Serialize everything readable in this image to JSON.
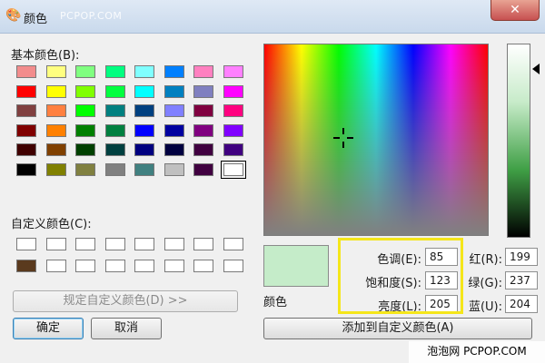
{
  "window": {
    "title": "颜色",
    "watermark_top": "PCPOP.COM",
    "close_glyph": "✕",
    "title_icon": "palette-icon"
  },
  "basic_colors": {
    "label": "基本颜色(B):",
    "rows": [
      [
        "#f28c8c",
        "#ffff80",
        "#80ff80",
        "#00ff80",
        "#80ffff",
        "#0080ff",
        "#ff80c0",
        "#ff80ff"
      ],
      [
        "#ff0000",
        "#ffff00",
        "#80ff00",
        "#00ff40",
        "#00ffff",
        "#0080c0",
        "#8080c0",
        "#ff00ff"
      ],
      [
        "#804040",
        "#ff8040",
        "#00ff00",
        "#008080",
        "#004080",
        "#8080ff",
        "#800040",
        "#ff0080"
      ],
      [
        "#800000",
        "#ff8000",
        "#008000",
        "#008040",
        "#0000ff",
        "#0000a0",
        "#800080",
        "#8000ff"
      ],
      [
        "#400000",
        "#804000",
        "#004000",
        "#004040",
        "#000080",
        "#000040",
        "#400040",
        "#400080"
      ],
      [
        "#000000",
        "#808000",
        "#808040",
        "#808080",
        "#408080",
        "#c0c0c0",
        "#400040",
        "#ffffff"
      ]
    ]
  },
  "custom_colors": {
    "label": "自定义颜色(C):",
    "rows": [
      [
        "#ffffff",
        "#ffffff",
        "#ffffff",
        "#ffffff",
        "#ffffff",
        "#ffffff",
        "#ffffff",
        "#ffffff"
      ],
      [
        "#5a3a1e",
        "#ffffff",
        "#ffffff",
        "#ffffff",
        "#ffffff",
        "#ffffff",
        "#ffffff",
        "#ffffff"
      ]
    ]
  },
  "buttons": {
    "define_custom": "规定自定义颜色(D) >>",
    "ok": "确定",
    "cancel": "取消",
    "add_custom": "添加到自定义颜色(A)"
  },
  "preview": {
    "label": "颜色",
    "color": "#c5ecc9"
  },
  "fields": {
    "hue_label": "色调(E):",
    "hue": "85",
    "sat_label": "饱和度(S):",
    "sat": "123",
    "lum_label": "亮度(L):",
    "lum": "205",
    "red_label": "红(R):",
    "red": "199",
    "green_label": "绿(G):",
    "green": "237",
    "blue_label": "蓝(U):",
    "blue": "204"
  },
  "watermark_bottom": "泡泡网 PCPOP.COM",
  "colors": {
    "highlight": "#f5e61a",
    "close_button": "#c75050"
  }
}
